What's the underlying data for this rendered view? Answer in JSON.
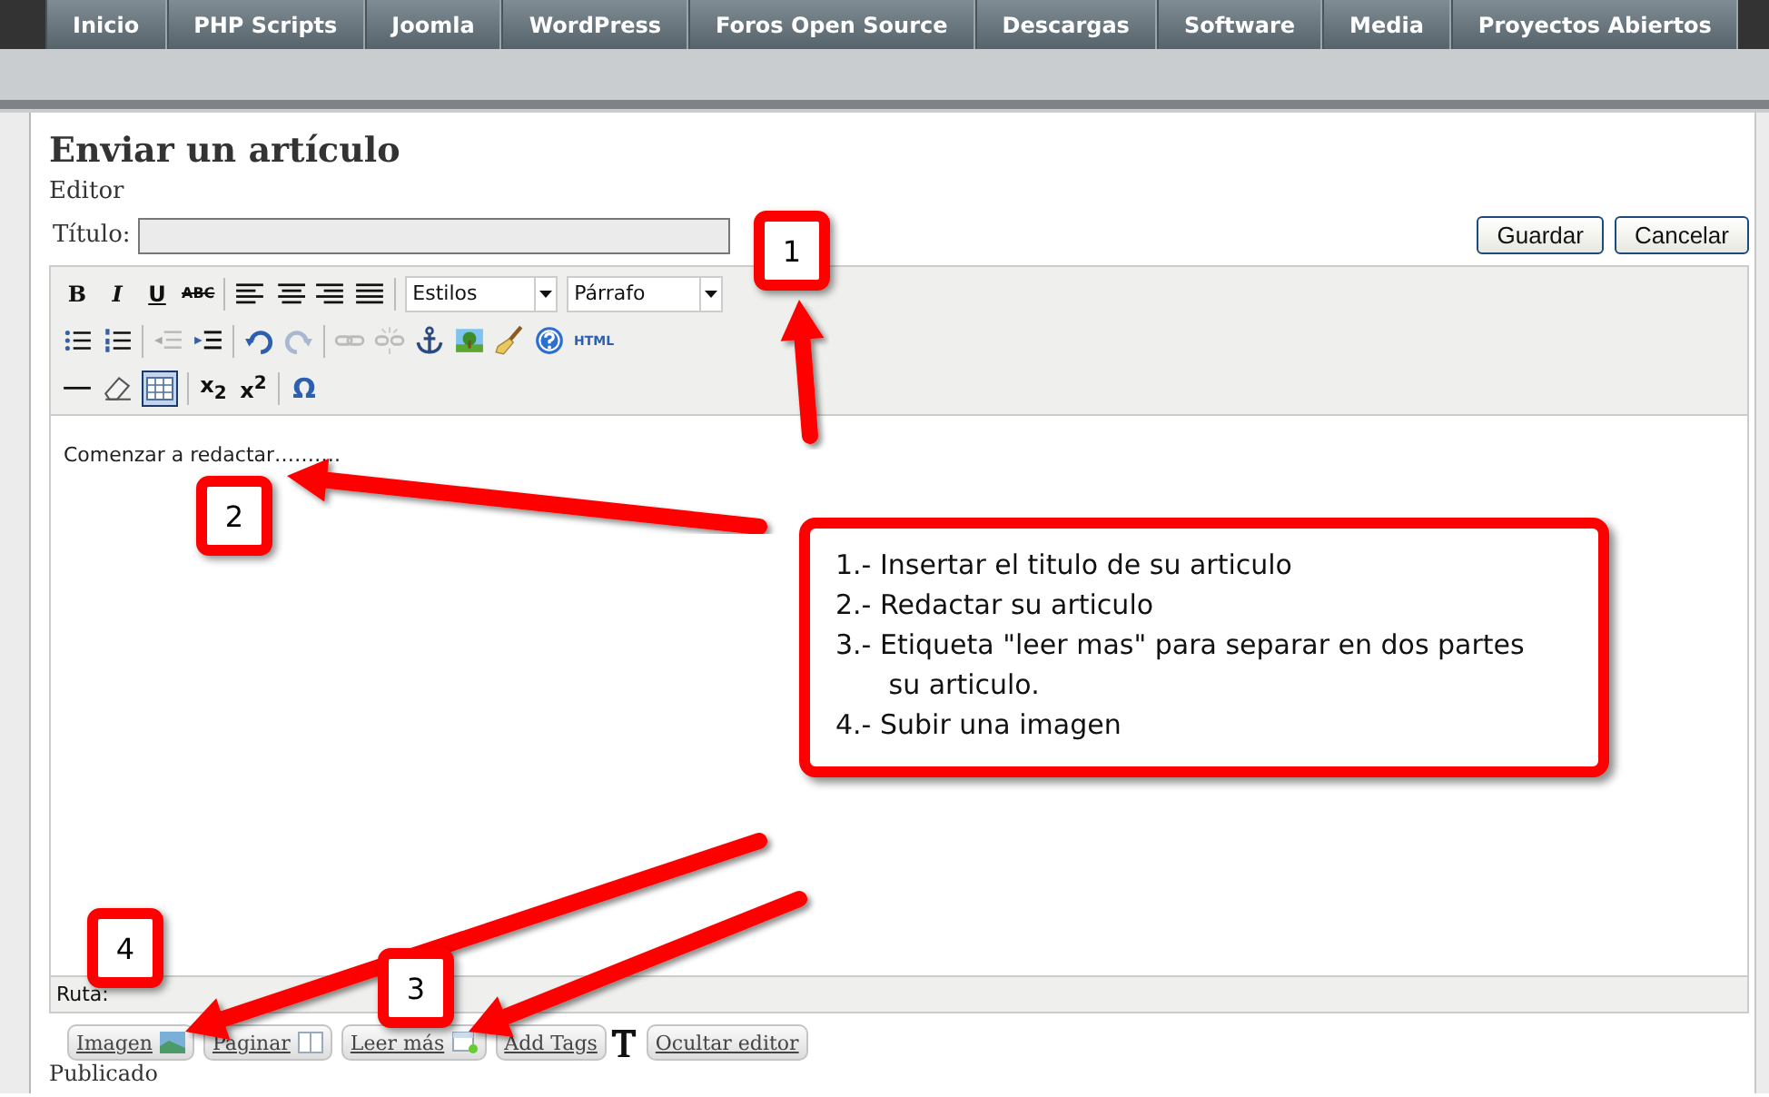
{
  "nav": [
    {
      "label": "Inicio",
      "selected": false
    },
    {
      "label": "PHP Scripts",
      "selected": false
    },
    {
      "label": "Joomla",
      "selected": false
    },
    {
      "label": "WordPress",
      "selected": false
    },
    {
      "label": "Foros Open Source",
      "selected": false
    },
    {
      "label": "Descargas",
      "selected": false
    },
    {
      "label": "Software",
      "selected": false
    },
    {
      "label": "Media",
      "selected": false
    },
    {
      "label": "Proyectos Abiertos",
      "selected": false
    }
  ],
  "page_title": "Enviar un artículo",
  "section_label": "Editor",
  "title_field": {
    "label": "Título:"
  },
  "actions": [
    "Guardar",
    "Cancelar"
  ],
  "toolbar": {
    "glyphs": [
      "B",
      "I",
      "U",
      "ABC",
      "HTML",
      "x$_{2}$",
      "x$^{2}$",
      "Ω"
    ],
    "styles_select": "Estilos",
    "format_select": "Párrafo"
  },
  "editor_text": "Comenzar a redactar……….",
  "status_path": "Ruta:",
  "bottom_buttons": [
    "Imagen",
    "Paginar",
    "Leer más",
    "Add Tags",
    "Ocultar editor"
  ],
  "footer_text": "Publicado",
  "callouts": [
    "1",
    "2",
    "3",
    "4"
  ],
  "instructions": [
    "1.- Insertar el titulo de su articulo",
    "2.- Redactar su articulo",
    "3.- Etiqueta \"leer mas\" para separar en dos partes su articulo.",
    "4.- Subir una imagen"
  ]
}
